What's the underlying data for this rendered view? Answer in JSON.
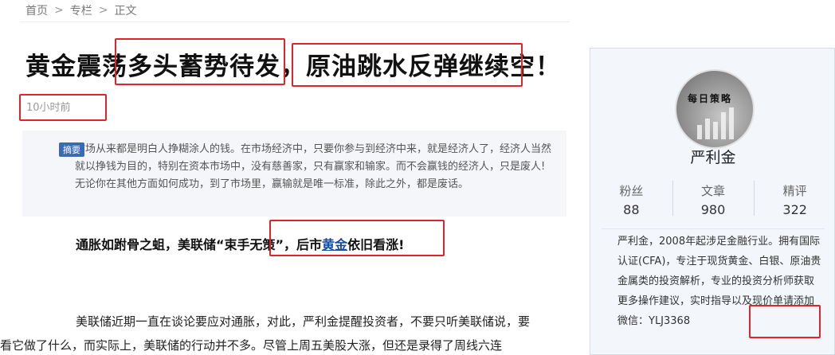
{
  "breadcrumb": {
    "home": "首页",
    "column": "专栏",
    "current": "正文",
    "sep": ">"
  },
  "article": {
    "title": "黄金震荡多头蓄势待发，原油跳水反弹继续空！",
    "time": "10小时前",
    "abstract_tag": "摘要",
    "abstract_text": "市场从来都是明白人挣糊涂人的钱。在市场经济中，只要你参与到经济中来，就是经济人了，经济人当然就以挣钱为目的，特别在资本市场中，没有慈善家，只有赢家和输家。而不会赢钱的经济人，只是废人!无论你在其他方面如何成功，到了市场里，赢输就是唯一标准，除此之外，都是废话。",
    "subhead_pre": "通胀如跗骨之蛆，美联储“束手无策”，后市",
    "subhead_kw": "黄金",
    "subhead_post": "依旧看涨!",
    "para_line1": "美联储近期一直在谈论要应对通胀，对此，严利金提醒投资者，不要只听美联储说，要",
    "para_line2": "看它做了什么，而实际上，美联储的行动并不多。尽管上周五美股大涨，但还是录得了周线六连"
  },
  "sidebar": {
    "avatar_text": "每日策略",
    "author": "严利金",
    "stats": [
      {
        "label": "粉丝",
        "value": "88"
      },
      {
        "label": "文章",
        "value": "980"
      },
      {
        "label": "精评",
        "value": "322"
      }
    ],
    "bio": "严利金，2008年起涉足金融行业。拥有国际认证(CFA)，专注于现货黄金、白银、原油贵金属类的投资解析，专业的投资分析师获取更多操作建议，实时指导以及现价单请添加微信：YLJ3368"
  },
  "colors": {
    "highlight": "#e0242a",
    "accent": "#3a6ab0",
    "sidebar_bg": "#f3f6fb"
  }
}
